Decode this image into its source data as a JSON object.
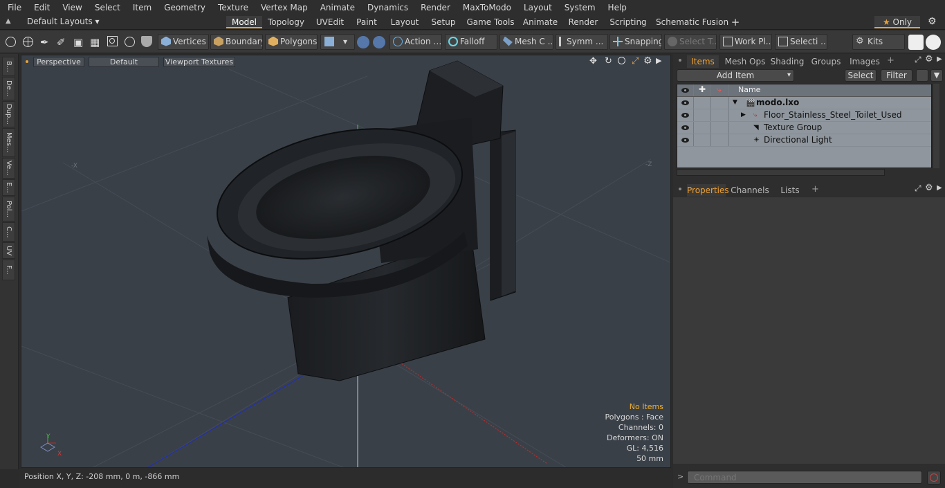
{
  "menu": [
    "File",
    "Edit",
    "View",
    "Select",
    "Item",
    "Geometry",
    "Texture",
    "Vertex Map",
    "Animate",
    "Dynamics",
    "Render",
    "MaxToModo",
    "Layout",
    "System",
    "Help"
  ],
  "layouts": {
    "selector": "Default Layouts",
    "tabs": [
      "Model",
      "Topology",
      "UVEdit",
      "Paint",
      "Layout",
      "Setup",
      "Game Tools",
      "Animate",
      "Render",
      "Scripting",
      "Schematic Fusion"
    ],
    "active": "Model",
    "add": "+",
    "only": "Only"
  },
  "toolbar": {
    "vertices": "Vertices",
    "boundary": "Boundary",
    "polygons": "Polygons",
    "action": "Action",
    "falloff": "Falloff",
    "mesh": "Mesh C ...",
    "symm": "Symm ...",
    "snapping": "Snapping",
    "select_t": "Select T...",
    "workplane": "Work Pl...",
    "selecti": "Selecti ...",
    "kits": "Kits"
  },
  "left_tabs": [
    "B...",
    "De...",
    "Dup...",
    "Mes...",
    "Ve...",
    "E...",
    "Pol...",
    "C...",
    "UV",
    "F..."
  ],
  "viewport": {
    "view": "Perspective",
    "shading": "Default",
    "textures": "Viewport Textures",
    "stats": {
      "no_items": "No Items",
      "polygons": "Polygons : Face",
      "channels": "Channels: 0",
      "deformers": "Deformers: ON",
      "gl": "GL: 4,516",
      "size": "50 mm"
    },
    "axis_labels": {
      "x_neg": "-X",
      "z_neg": "-Z"
    }
  },
  "status": {
    "position": "Position X, Y, Z:  -208 mm, 0 m, -866 mm"
  },
  "items_panel": {
    "tabs": [
      "Items",
      "Mesh Ops",
      "Shading",
      "Groups",
      "Images"
    ],
    "active": "Items",
    "add_item": "Add Item",
    "select": "Select",
    "filter": "Filter",
    "column_name": "Name",
    "rows": [
      {
        "label": "modo.lxo"
      },
      {
        "label": "Floor_Stainless_Steel_Toilet_Used"
      },
      {
        "label": "Texture Group"
      },
      {
        "label": "Directional Light"
      }
    ]
  },
  "props_panel": {
    "tabs": [
      "Properties",
      "Channels",
      "Lists"
    ],
    "active": "Properties"
  },
  "command": {
    "placeholder": "Command"
  },
  "colors": {
    "accent": "#e8a33a",
    "viewport_bg": "#3a4048",
    "x_axis": "#b03030",
    "y_axis": "#30c030",
    "z_axis": "#2030b0"
  }
}
